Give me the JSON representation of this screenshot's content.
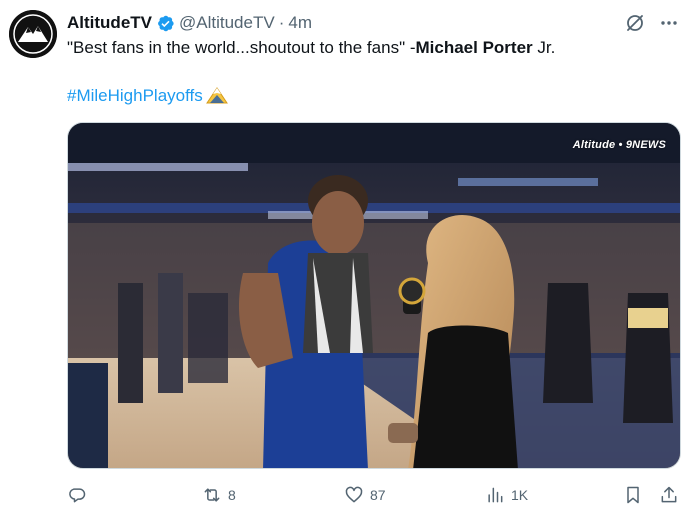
{
  "author": {
    "name": "AltitudeTV",
    "handle": "@AltitudeTV",
    "separator": "·",
    "time": "4m",
    "avatar_icon": "altitude-mountain-logo",
    "verified_icon": "verified-badge-icon",
    "verified_color": "#1d9bf0"
  },
  "post": {
    "quote": "\"Best fans in the world...shoutout to the fans\" -",
    "speaker_bold": "Michael Porter",
    "speaker_suffix": " Jr.",
    "hashtag": "#MileHighPlayoffs",
    "emoji_icon": "mountain-peak-emoji"
  },
  "media": {
    "description_icon": "video-thumbnail",
    "watermark": "Altitude • 9NEWS"
  },
  "actions": {
    "replies": "",
    "reposts": "8",
    "likes": "87",
    "views": "1K"
  },
  "colors": {
    "text": "#0f1419",
    "secondary": "#536471",
    "link": "#1d9bf0"
  }
}
